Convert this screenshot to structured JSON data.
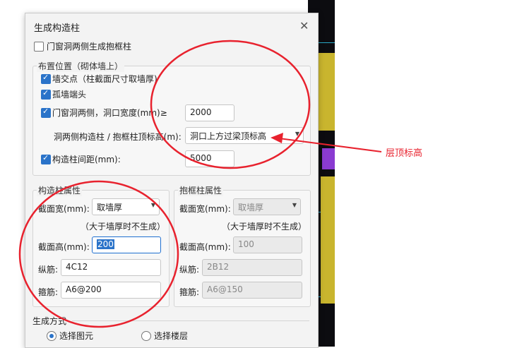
{
  "dialog": {
    "title": "生成构造柱",
    "close_icon": "close-icon",
    "door_window_frame_checkbox": {
      "label": "门窗洞两侧生成抱框柱",
      "checked": false
    }
  },
  "placement": {
    "group_label": "布置位置（砌体墙上）",
    "wall_intersection": {
      "label": "墙交点（柱截面尺寸取墙厚)",
      "checked": true
    },
    "isolated_wall_end": {
      "label": "孤墙端头",
      "checked": true
    },
    "door_window_sides": {
      "label": "门窗洞两侧，洞口宽度(mm)≥",
      "checked": true,
      "value": "2000"
    },
    "top_elevation": {
      "label": "洞两侧构造柱 / 抱框柱顶标高(m):",
      "value": "洞口上方过梁顶标高"
    },
    "column_spacing": {
      "label": "构造柱间距(mm):",
      "checked": true,
      "value": "5000"
    }
  },
  "construction_column": {
    "group_label": "构造柱属性",
    "width_label": "截面宽(mm):",
    "width_value": "取墙厚",
    "note": "（大于墙厚时不生成）",
    "height_label": "截面高(mm):",
    "height_value": "200",
    "long_rebar_label": "纵筋:",
    "long_rebar_value": "4C12",
    "stirrup_label": "箍筋:",
    "stirrup_value": "A6@200"
  },
  "frame_column": {
    "group_label": "抱框柱属性",
    "width_label": "截面宽(mm):",
    "width_value": "取墙厚",
    "note": "（大于墙厚时不生成）",
    "height_label": "截面高(mm):",
    "height_value": "100",
    "long_rebar_label": "纵筋:",
    "long_rebar_value": "2B12",
    "stirrup_label": "箍筋:",
    "stirrup_value": "A6@150"
  },
  "generation": {
    "section_label": "生成方式",
    "select_elements": {
      "label": "选择图元",
      "selected": true
    },
    "select_floors": {
      "label": "选择楼层",
      "selected": false
    }
  },
  "annotation": {
    "text": "层顶标高",
    "color": "#e8222e"
  }
}
